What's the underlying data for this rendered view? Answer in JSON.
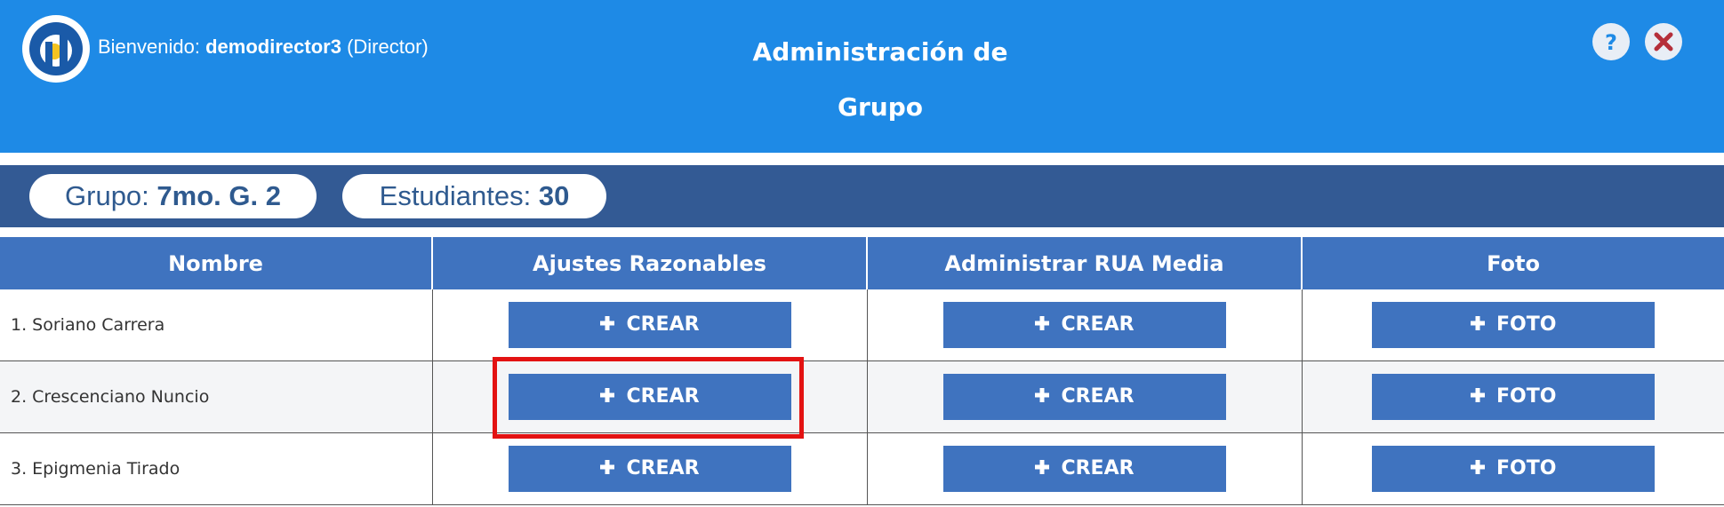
{
  "header": {
    "welcome_prefix": "Bienvenido:",
    "username": "demodirector3",
    "role": "(Director)",
    "title_line1": "Administración de",
    "title_line2": "Grupo",
    "help_icon": "question-icon",
    "close_icon": "close-icon"
  },
  "groupbar": {
    "group_label": "Grupo:",
    "group_value": "7mo. G. 2",
    "students_label": "Estudiantes:",
    "students_value": "30"
  },
  "table": {
    "columns": [
      "Nombre",
      "Ajustes Razonables",
      "Administrar RUA Media",
      "Foto"
    ],
    "rows": [
      {
        "name": "1. Soriano Carrera",
        "ajustes": "CREAR",
        "rua": "CREAR",
        "foto": "FOTO"
      },
      {
        "name": "2. Crescenciano Nuncio",
        "ajustes": "CREAR",
        "rua": "CREAR",
        "foto": "FOTO"
      },
      {
        "name": "3. Epigmenia Tirado",
        "ajustes": "CREAR",
        "rua": "CREAR",
        "foto": "FOTO"
      }
    ]
  },
  "colors": {
    "header_bg": "#1e8ae6",
    "groupbar_bg": "#335a94",
    "button_bg": "#3f73bf",
    "highlight": "#e31212"
  }
}
